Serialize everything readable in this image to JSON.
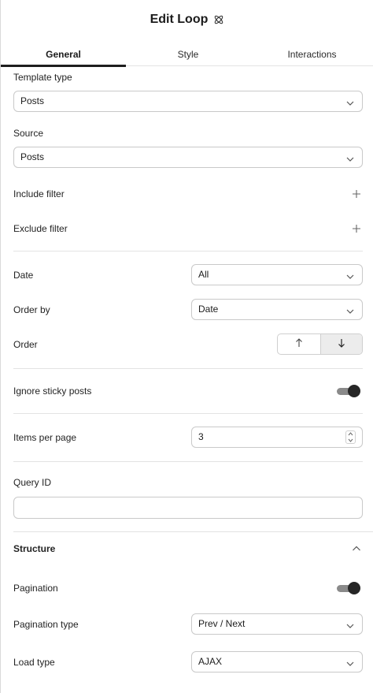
{
  "header": {
    "title": "Edit Loop",
    "icon": "atom-icon"
  },
  "tabs": [
    {
      "label": "General",
      "active": true
    },
    {
      "label": "Style",
      "active": false
    },
    {
      "label": "Interactions",
      "active": false
    }
  ],
  "general": {
    "template_type": {
      "label": "Template type",
      "value": "Posts"
    },
    "source": {
      "label": "Source",
      "value": "Posts"
    },
    "include_filter": {
      "label": "Include filter"
    },
    "exclude_filter": {
      "label": "Exclude filter"
    },
    "date": {
      "label": "Date",
      "value": "All"
    },
    "order_by": {
      "label": "Order by",
      "value": "Date"
    },
    "order": {
      "label": "Order",
      "options": [
        "ascending",
        "descending"
      ],
      "selected": "descending"
    },
    "ignore_sticky": {
      "label": "Ignore sticky posts",
      "on": true
    },
    "items_per_page": {
      "label": "Items per page",
      "value": "3"
    },
    "query_id": {
      "label": "Query ID",
      "value": ""
    }
  },
  "structure": {
    "title": "Structure",
    "expanded": true,
    "pagination": {
      "label": "Pagination",
      "on": true
    },
    "pagination_type": {
      "label": "Pagination type",
      "value": "Prev / Next"
    },
    "load_type": {
      "label": "Load type",
      "value": "AJAX"
    }
  }
}
